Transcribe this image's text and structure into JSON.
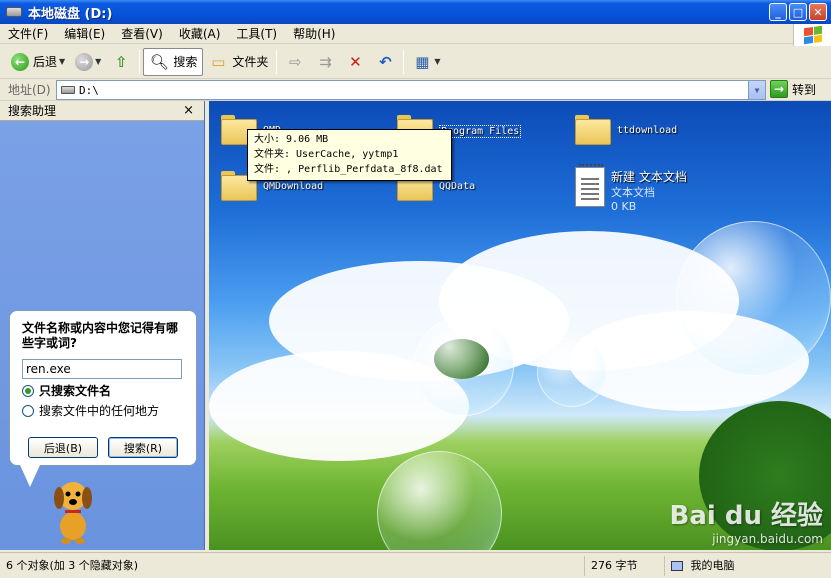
{
  "window": {
    "title": "本地磁盘  (D:)",
    "minimize": "_",
    "maximize": "□",
    "close": "✕"
  },
  "menu": [
    {
      "label": "文件(F)"
    },
    {
      "label": "编辑(E)"
    },
    {
      "label": "查看(V)"
    },
    {
      "label": "收藏(A)"
    },
    {
      "label": "工具(T)"
    },
    {
      "label": "帮助(H)"
    }
  ],
  "toolbar": {
    "back": "后退",
    "search": "搜索",
    "folders": "文件夹"
  },
  "address": {
    "label": "地址(D)",
    "value": "D:\\",
    "go": "转到"
  },
  "search_pane": {
    "title": "搜索助理",
    "close": "×",
    "question": "文件名称或内容中您记得有哪些字或词?",
    "input_value": "ren.exe",
    "option_filename": "只搜索文件名",
    "option_content": "搜索文件中的任何地方",
    "back_button": "后退(B)",
    "search_button": "搜索(R)"
  },
  "files": [
    {
      "name": "QMD...",
      "type": "folder"
    },
    {
      "name": "Program Files",
      "type": "folder"
    },
    {
      "name": "ttdownload",
      "type": "folder"
    },
    {
      "name": "QMDownload",
      "type": "folder"
    },
    {
      "name": "QQData",
      "type": "folder"
    },
    {
      "name": "新建 文本文档",
      "type": "text",
      "subtype": "文本文档",
      "size": "0 KB"
    }
  ],
  "tooltip": {
    "line1": "大小: 9.06 MB",
    "line2": "文件夹: UserCache, yytmp1",
    "line3": "文件: , Perflib_Perfdata_8f8.dat"
  },
  "status": {
    "objects": "6 个对象(加 3 个隐藏对象)",
    "size": "276 字节",
    "location": "我的电脑"
  },
  "watermark": {
    "brand": "Bai du 经验",
    "url": "jingyan.baidu.com"
  }
}
